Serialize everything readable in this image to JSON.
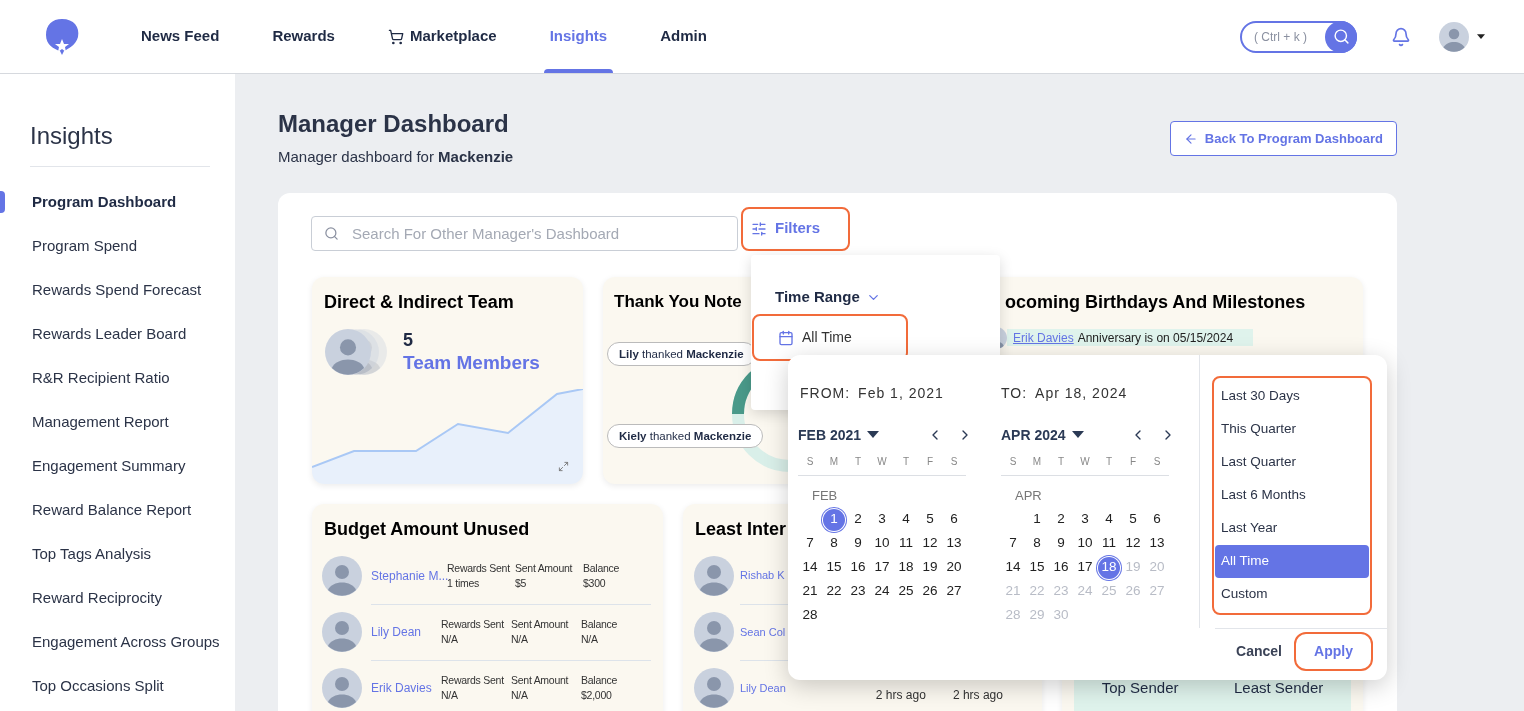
{
  "nav": {
    "items": [
      {
        "label": "News Feed",
        "kind": "plain",
        "selected": false
      },
      {
        "label": "Rewards",
        "kind": "plain",
        "selected": false
      },
      {
        "label": "Marketplace",
        "kind": "cart",
        "selected": false
      },
      {
        "label": "Insights",
        "kind": "plain",
        "selected": true
      },
      {
        "label": "Admin",
        "kind": "plain",
        "selected": false
      }
    ],
    "search_hint": "( Ctrl + k )"
  },
  "sidebar": {
    "title": "Insights",
    "items": [
      {
        "label": "Program Dashboard",
        "selected": true
      },
      {
        "label": "Program Spend",
        "selected": false
      },
      {
        "label": "Rewards Spend Forecast",
        "selected": false
      },
      {
        "label": "Rewards Leader Board",
        "selected": false
      },
      {
        "label": "R&R Recipient Ratio",
        "selected": false
      },
      {
        "label": "Management Report",
        "selected": false
      },
      {
        "label": "Engagement Summary",
        "selected": false
      },
      {
        "label": "Reward Balance Report",
        "selected": false
      },
      {
        "label": "Top Tags Analysis",
        "selected": false
      },
      {
        "label": "Reward Reciprocity",
        "selected": false
      },
      {
        "label": "Engagement Across Groups",
        "selected": false
      },
      {
        "label": "Top Occasions Split",
        "selected": false
      }
    ]
  },
  "page": {
    "title": "Manager Dashboard",
    "subtitle": "Manager dashboard for **Mackenzie**",
    "back_button": "Back To Program Dashboard"
  },
  "search": {
    "placeholder": "Search For Other Manager's Dashboard"
  },
  "filters_button": "Filters",
  "cards": [
    {
      "kind": "team",
      "title": "Direct & Indirect Team",
      "count": "5",
      "label": "Team Members"
    },
    {
      "kind": "notes",
      "title": "Thank You Note",
      "notes": [
        "**Lily** thanked **Mackenzie**",
        "**Kiely** thanked **Mackenzie**"
      ]
    },
    {
      "kind": "milestones",
      "title": "ocoming Birthdays And Milestones",
      "events": [
        {
          "name": "Erik Davies",
          "text": "Anniversary is on 05/15/2024"
        }
      ]
    },
    {
      "kind": "budget",
      "title": "Budget Amount Unused",
      "rows": [
        {
          "name": "Stephanie M...",
          "cells": [
            {
              "label": "Rewards Sent",
              "value": "1 times"
            },
            {
              "label": "Sent Amount",
              "value": "$5"
            },
            {
              "label": "Balance",
              "value": "$300"
            }
          ]
        },
        {
          "name": "Lily Dean",
          "cells": [
            {
              "label": "Rewards Sent",
              "value": "N/A"
            },
            {
              "label": "Sent Amount",
              "value": "N/A"
            },
            {
              "label": "Balance",
              "value": "N/A"
            }
          ]
        },
        {
          "name": "Erik Davies",
          "cells": [
            {
              "label": "Rewards Sent",
              "value": "N/A"
            },
            {
              "label": "Sent Amount",
              "value": "N/A"
            },
            {
              "label": "Balance",
              "value": "$2,000"
            }
          ]
        }
      ]
    },
    {
      "kind": "interactions",
      "title": "Least Inter",
      "rows": [
        {
          "name": "Rishab K",
          "times": []
        },
        {
          "name": "Sean Col",
          "times": []
        },
        {
          "name": "Lily Dean",
          "times": [
            "2 hrs ago",
            "2 hrs ago"
          ]
        }
      ]
    },
    {
      "kind": "senders",
      "labels": [
        "Top Sender",
        "Least Sender"
      ]
    }
  ],
  "filter_menu": {
    "heading": "Time Range",
    "option": "All Time"
  },
  "date_picker": {
    "from_label": "FROM:",
    "from": "Feb 1, 2021",
    "to_label": "TO:",
    "to": "Apr 18, 2024",
    "months": [
      {
        "title": "FEB 2021",
        "label": "FEB",
        "weekdays": [
          "S",
          "M",
          "T",
          "W",
          "T",
          "F",
          "S"
        ],
        "weeks": [
          {
            "leading_gap": true,
            "days": [
              {
                "t": "1",
                "selected": true,
                "disabled": false
              },
              {
                "t": "2",
                "selected": false,
                "disabled": false
              },
              {
                "t": "3",
                "selected": false,
                "disabled": false
              },
              {
                "t": "4",
                "selected": false,
                "disabled": false
              },
              {
                "t": "5",
                "selected": false,
                "disabled": false
              },
              {
                "t": "6",
                "selected": false,
                "disabled": false
              }
            ]
          },
          {
            "leading_gap": false,
            "days": [
              {
                "t": "7",
                "selected": false,
                "disabled": false
              },
              {
                "t": "8",
                "selected": false,
                "disabled": false
              },
              {
                "t": "9",
                "selected": false,
                "disabled": false
              },
              {
                "t": "10",
                "selected": false,
                "disabled": false
              },
              {
                "t": "11",
                "selected": false,
                "disabled": false
              },
              {
                "t": "12",
                "selected": false,
                "disabled": false
              },
              {
                "t": "13",
                "selected": false,
                "disabled": false
              }
            ]
          },
          {
            "leading_gap": false,
            "days": [
              {
                "t": "14",
                "selected": false,
                "disabled": false
              },
              {
                "t": "15",
                "selected": false,
                "disabled": false
              },
              {
                "t": "16",
                "selected": false,
                "disabled": false
              },
              {
                "t": "17",
                "selected": false,
                "disabled": false
              },
              {
                "t": "18",
                "selected": false,
                "disabled": false
              },
              {
                "t": "19",
                "selected": false,
                "disabled": false
              },
              {
                "t": "20",
                "selected": false,
                "disabled": false
              }
            ]
          },
          {
            "leading_gap": false,
            "days": [
              {
                "t": "21",
                "selected": false,
                "disabled": false
              },
              {
                "t": "22",
                "selected": false,
                "disabled": false
              },
              {
                "t": "23",
                "selected": false,
                "disabled": false
              },
              {
                "t": "24",
                "selected": false,
                "disabled": false
              },
              {
                "t": "25",
                "selected": false,
                "disabled": false
              },
              {
                "t": "26",
                "selected": false,
                "disabled": false
              },
              {
                "t": "27",
                "selected": false,
                "disabled": false
              }
            ]
          },
          {
            "leading_gap": false,
            "days": [
              {
                "t": "28",
                "selected": false,
                "disabled": false
              }
            ]
          }
        ]
      },
      {
        "title": "APR 2024",
        "label": "APR",
        "weekdays": [
          "S",
          "M",
          "T",
          "W",
          "T",
          "F",
          "S"
        ],
        "weeks": [
          {
            "leading_gap": true,
            "days": [
              {
                "t": "1",
                "selected": false,
                "disabled": false
              },
              {
                "t": "2",
                "selected": false,
                "disabled": false
              },
              {
                "t": "3",
                "selected": false,
                "disabled": false
              },
              {
                "t": "4",
                "selected": false,
                "disabled": false
              },
              {
                "t": "5",
                "selected": false,
                "disabled": false
              },
              {
                "t": "6",
                "selected": false,
                "disabled": false
              }
            ]
          },
          {
            "leading_gap": false,
            "days": [
              {
                "t": "7",
                "selected": false,
                "disabled": false
              },
              {
                "t": "8",
                "selected": false,
                "disabled": false
              },
              {
                "t": "9",
                "selected": false,
                "disabled": false
              },
              {
                "t": "10",
                "selected": false,
                "disabled": false
              },
              {
                "t": "11",
                "selected": false,
                "disabled": false
              },
              {
                "t": "12",
                "selected": false,
                "disabled": false
              },
              {
                "t": "13",
                "selected": false,
                "disabled": false
              }
            ]
          },
          {
            "leading_gap": false,
            "days": [
              {
                "t": "14",
                "selected": false,
                "disabled": false
              },
              {
                "t": "15",
                "selected": false,
                "disabled": false
              },
              {
                "t": "16",
                "selected": false,
                "disabled": false
              },
              {
                "t": "17",
                "selected": false,
                "disabled": false
              },
              {
                "t": "18",
                "selected": true,
                "disabled": false
              },
              {
                "t": "19",
                "selected": false,
                "disabled": true
              },
              {
                "t": "20",
                "selected": false,
                "disabled": true
              }
            ]
          },
          {
            "leading_gap": false,
            "days": [
              {
                "t": "21",
                "selected": false,
                "disabled": true
              },
              {
                "t": "22",
                "selected": false,
                "disabled": true
              },
              {
                "t": "23",
                "selected": false,
                "disabled": true
              },
              {
                "t": "24",
                "selected": false,
                "disabled": true
              },
              {
                "t": "25",
                "selected": false,
                "disabled": true
              },
              {
                "t": "26",
                "selected": false,
                "disabled": true
              },
              {
                "t": "27",
                "selected": false,
                "disabled": true
              }
            ]
          },
          {
            "leading_gap": false,
            "days": [
              {
                "t": "28",
                "selected": false,
                "disabled": true
              },
              {
                "t": "29",
                "selected": false,
                "disabled": true
              },
              {
                "t": "30",
                "selected": false,
                "disabled": true
              }
            ]
          }
        ]
      }
    ],
    "presets": [
      {
        "label": "Last 30 Days",
        "selected": false
      },
      {
        "label": "This Quarter",
        "selected": false
      },
      {
        "label": "Last Quarter",
        "selected": false
      },
      {
        "label": "Last 6 Months",
        "selected": false
      },
      {
        "label": "Last Year",
        "selected": false
      },
      {
        "label": "All Time",
        "selected": true
      },
      {
        "label": "Custom",
        "selected": false
      }
    ],
    "cancel": "Cancel",
    "apply": "Apply"
  }
}
